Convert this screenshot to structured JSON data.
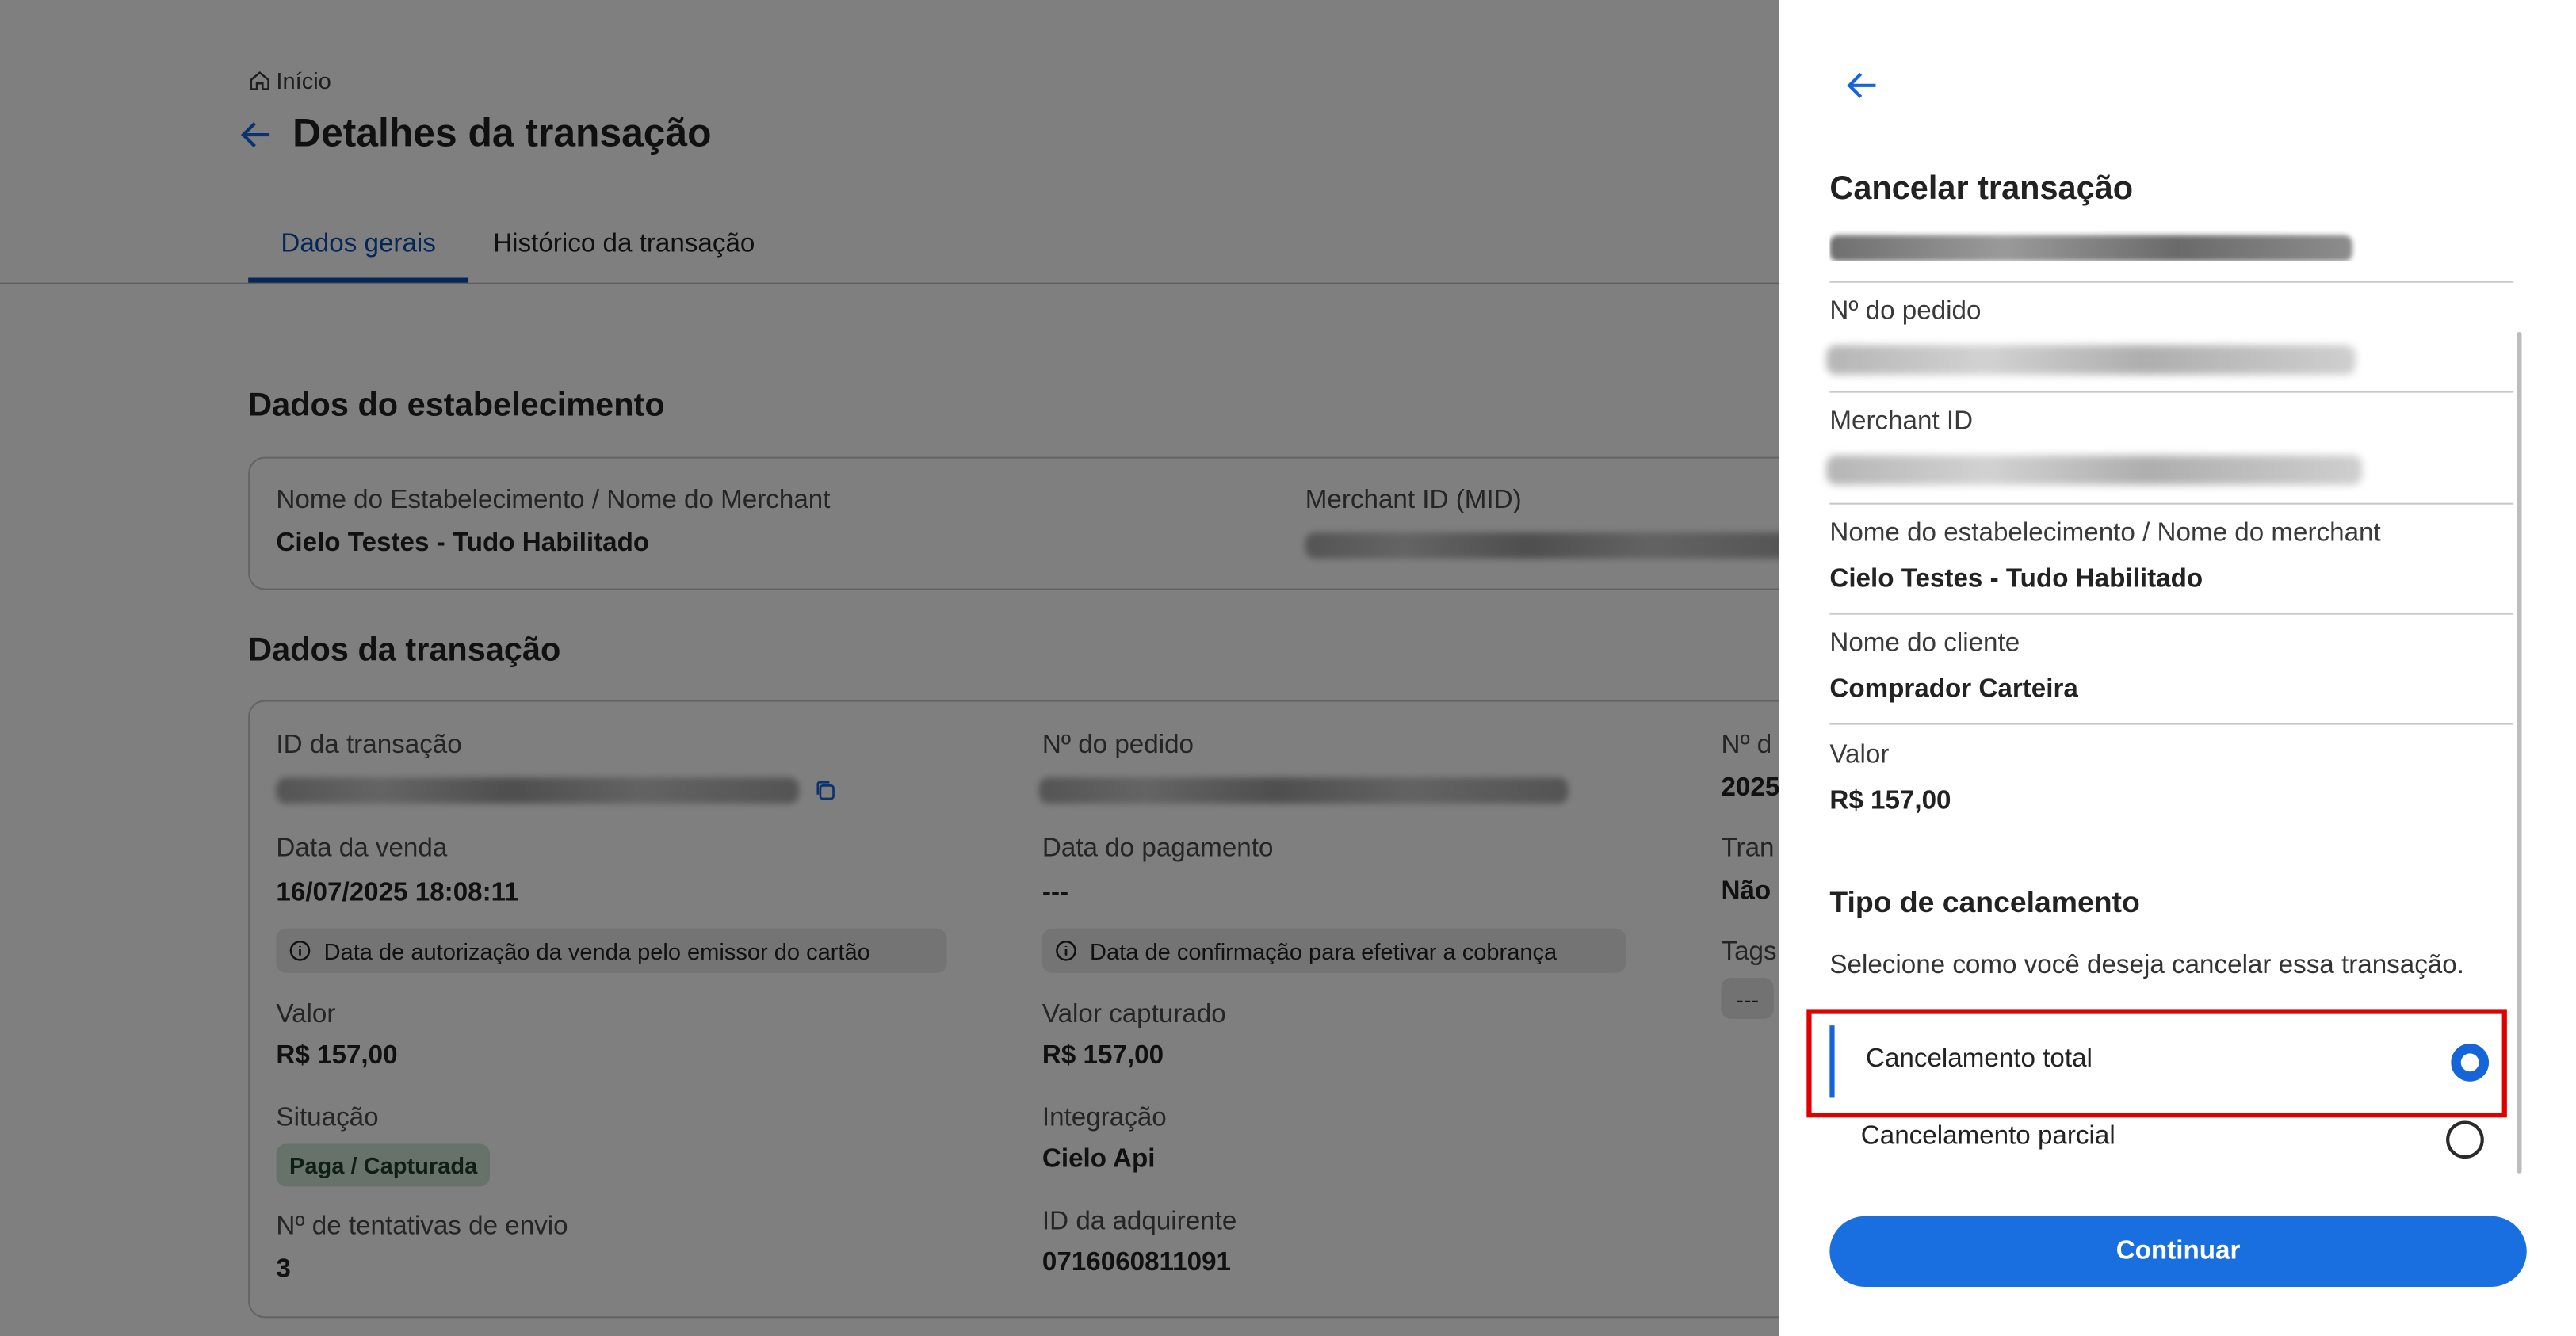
{
  "colors": {
    "accent": "#1565d8",
    "badge_bg": "#cfe7d4",
    "highlight": "#e00000",
    "overlay": "rgba(0,0,0,0.5)"
  },
  "breadcrumb": {
    "home_label": "Início"
  },
  "page": {
    "title": "Detalhes da transação"
  },
  "tabs": [
    {
      "label": "Dados gerais",
      "active": true
    },
    {
      "label": "Histórico da transação",
      "active": false
    }
  ],
  "establishment": {
    "section_title": "Dados do estabelecimento",
    "name_label": "Nome do Estabelecimento / Nome do Merchant",
    "name_value": "Cielo Testes - Tudo Habilitado",
    "mid_label": "Merchant ID (MID)"
  },
  "transaction": {
    "section_title": "Dados da transação",
    "id_label": "ID da transação",
    "order_label": "Nº do pedido",
    "third_col_label": "Nº d",
    "third_col_value": "2025",
    "sale_date_label": "Data da venda",
    "sale_date_value": "16/07/2025 18:08:11",
    "sale_date_note": "Data de autorização da venda pelo emissor do cartão",
    "payment_date_label": "Data do pagamento",
    "payment_date_value": "---",
    "payment_date_note": "Data de confirmação para efetivar a cobrança",
    "tran_label": "Tran",
    "tran_value": "Não",
    "tags_label": "Tags",
    "tags_value": "---",
    "value_label": "Valor",
    "value_value": "R$ 157,00",
    "captured_label": "Valor capturado",
    "captured_value": "R$ 157,00",
    "status_label": "Situação",
    "status_value": "Paga / Capturada",
    "integration_label": "Integração",
    "integration_value": "Cielo Api",
    "attempts_label": "Nº de tentativas de envio",
    "attempts_value": "3",
    "acquirer_label": "ID da adquirente",
    "acquirer_value": "0716060811091"
  },
  "drawer": {
    "title": "Cancelar transação",
    "fields": {
      "order_label": "Nº do pedido",
      "merchant_id_label": "Merchant ID",
      "establishment_label": "Nome do estabelecimento / Nome do merchant",
      "establishment_value": "Cielo Testes - Tudo Habilitado",
      "client_label": "Nome do cliente",
      "client_value": "Comprador Carteira",
      "value_label": "Valor",
      "value_value": "R$ 157,00"
    },
    "cancel_type_title": "Tipo de cancelamento",
    "cancel_type_helper": "Selecione como você deseja cancelar essa transação.",
    "options": [
      {
        "label": "Cancelamento total",
        "selected": true
      },
      {
        "label": "Cancelamento parcial",
        "selected": false
      }
    ],
    "continue_label": "Continuar"
  }
}
